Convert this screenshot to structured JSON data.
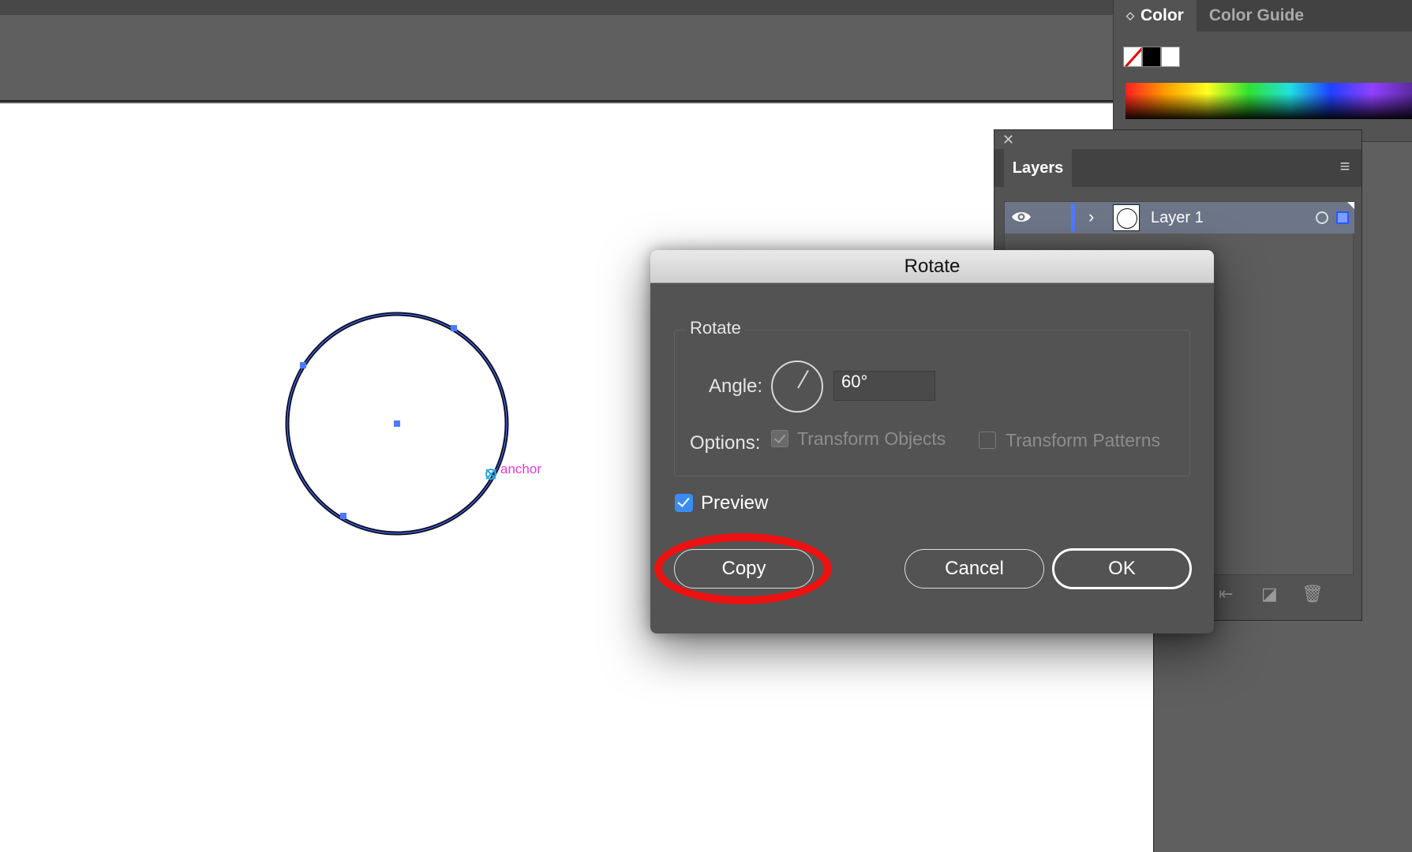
{
  "canvas": {
    "anchor_label": "anchor"
  },
  "color_panel": {
    "tabs": [
      {
        "label": "Color",
        "active": true
      },
      {
        "label": "Color Guide",
        "active": false
      }
    ],
    "updown_glyph": "◇",
    "swatches": [
      "none-swatch",
      "black-swatch",
      "white-swatch"
    ]
  },
  "layers_panel": {
    "close_glyph": "✕",
    "title": "Layers",
    "menu_glyph": "≡",
    "layers": [
      {
        "name": "Layer 1",
        "visible": true,
        "expanded": false,
        "color": "#4b7bff"
      }
    ],
    "footer_icons": [
      "move-to-layer-icon",
      "new-layer-icon",
      "trash-icon"
    ]
  },
  "rotate_dialog": {
    "title": "Rotate",
    "group_label": "Rotate",
    "angle_label": "Angle:",
    "angle_value": "60°",
    "options_label": "Options:",
    "transform_objects_label": "Transform Objects",
    "transform_objects_checked": true,
    "transform_patterns_label": "Transform Patterns",
    "transform_patterns_checked": false,
    "preview_label": "Preview",
    "preview_checked": true,
    "copy_label": "Copy",
    "cancel_label": "Cancel",
    "ok_label": "OK"
  },
  "colors": {
    "selection": "#4a7bff",
    "anchor_label": "#e03ad6",
    "highlight": "#ee1111",
    "checkbox_accent": "#3b8cf0"
  }
}
